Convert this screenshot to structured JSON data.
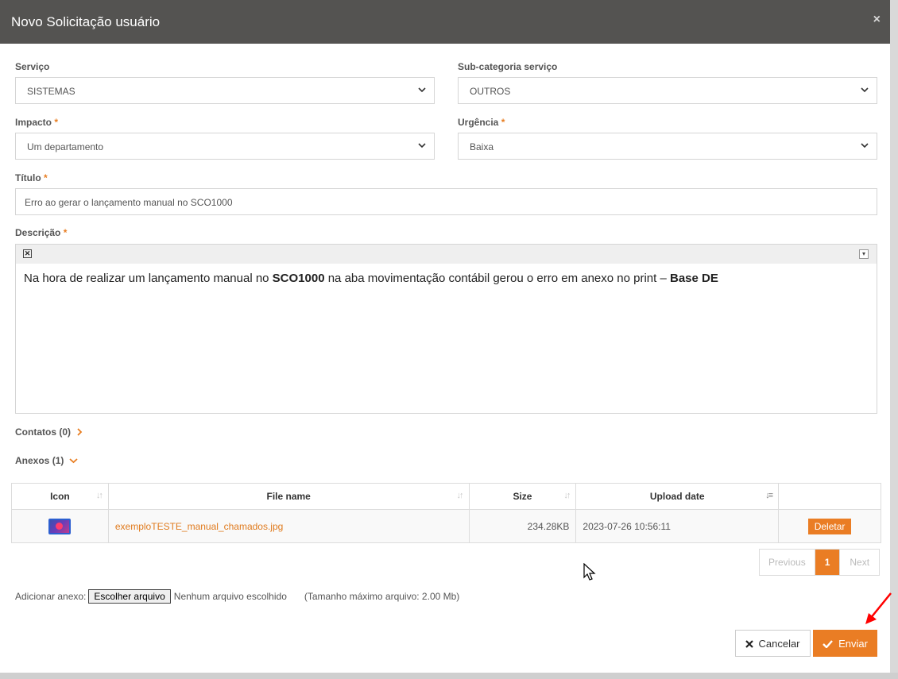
{
  "dialog": {
    "title": "Novo Solicitação usuário",
    "close_glyph": "×"
  },
  "form": {
    "servico": {
      "label": "Serviço",
      "value": "SISTEMAS"
    },
    "subcategoria": {
      "label": "Sub-categoria serviço",
      "value": "OUTROS"
    },
    "impacto": {
      "label": "Impacto",
      "value": "Um departamento"
    },
    "urgencia": {
      "label": "Urgência",
      "value": "Baixa"
    },
    "titulo": {
      "label": "Título",
      "value": "Erro ao gerar o lançamento manual no SCO1000"
    },
    "descricao": {
      "label": "Descrição",
      "text_part1": "Na hora de realizar um lançamento manual no ",
      "bold1": "SCO1000",
      "text_part2": " na aba movimentação contábil gerou o erro em anexo no print – ",
      "bold2": "Base DE"
    },
    "required_mark": "*"
  },
  "sections": {
    "contatos": "Contatos",
    "contatos_count": "(0)",
    "anexos": "Anexos",
    "anexos_count": "(1)"
  },
  "attachments_table": {
    "columns": [
      "Icon",
      "File name",
      "Size",
      "Upload date",
      ""
    ],
    "rows": [
      {
        "icon": "image-file-icon",
        "file_name": "exemploTESTE_manual_chamados.jpg",
        "size": "234.28KB",
        "upload_date": "2023-07-26 10:56:11",
        "action": "Deletar"
      }
    ]
  },
  "pagination": {
    "previous": "Previous",
    "current": "1",
    "next": "Next"
  },
  "attach": {
    "label": "Adicionar anexo:",
    "button": "Escolher arquivo",
    "status": "Nenhum arquivo escolhido",
    "note": "(Tamanho máximo arquivo: 2.00 Mb)"
  },
  "buttons": {
    "cancel": "Cancelar",
    "send": "Enviar"
  },
  "colors": {
    "accent": "#ea7d24",
    "header_bg": "#545351",
    "annotation_arrow": "#ff0000"
  }
}
